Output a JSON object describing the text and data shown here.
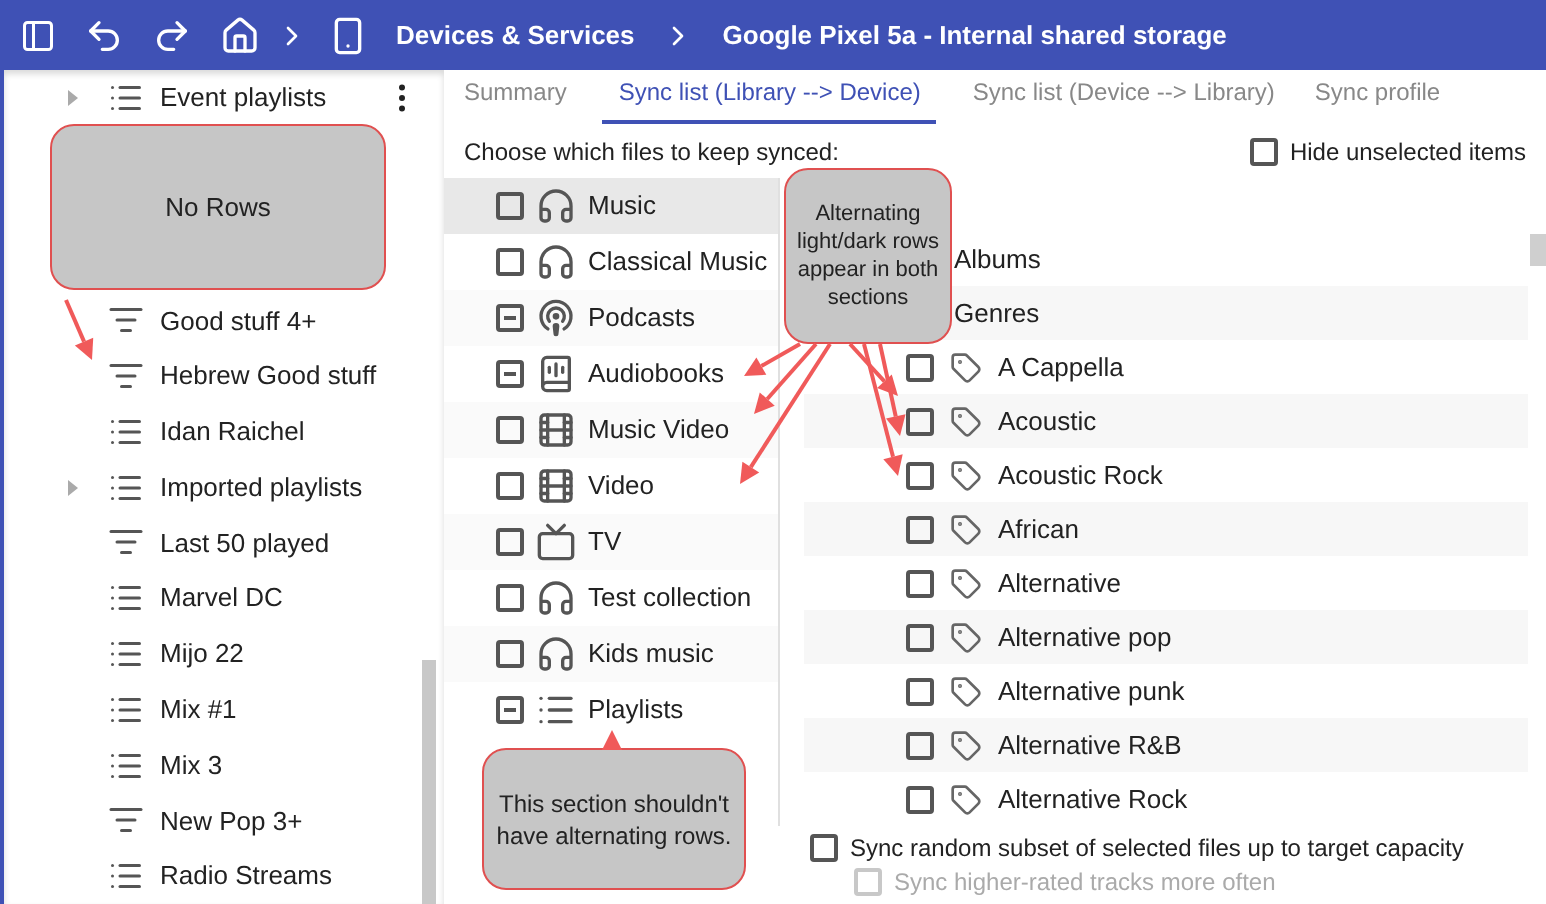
{
  "toolbar": {
    "breadcrumb": [
      "Devices & Services",
      "Google Pixel 5a - Internal shared storage"
    ]
  },
  "sidebar": {
    "items_before": [
      {
        "label": "Event playlists",
        "kind": "list",
        "expandable": true
      }
    ],
    "items_after": [
      {
        "label": "Good stuff 4+",
        "kind": "smart",
        "expandable": false
      },
      {
        "label": "Hebrew Good stuff",
        "kind": "smart",
        "expandable": false
      },
      {
        "label": "Idan Raichel",
        "kind": "list",
        "expandable": false
      },
      {
        "label": "Imported playlists",
        "kind": "list",
        "expandable": true
      },
      {
        "label": "Last 50 played",
        "kind": "smart",
        "expandable": false
      },
      {
        "label": "Marvel DC",
        "kind": "list",
        "expandable": false
      },
      {
        "label": "Mijo 22",
        "kind": "list",
        "expandable": false
      },
      {
        "label": "Mix #1",
        "kind": "list",
        "expandable": false
      },
      {
        "label": "Mix 3",
        "kind": "list",
        "expandable": false
      },
      {
        "label": "New Pop 3+",
        "kind": "smart",
        "expandable": false
      },
      {
        "label": "Radio Streams",
        "kind": "list",
        "expandable": false
      }
    ]
  },
  "tabs": [
    {
      "label": "Summary",
      "selected": false
    },
    {
      "label": "Sync list (Library --> Device)",
      "selected": true
    },
    {
      "label": "Sync list (Device --> Library)",
      "selected": false
    },
    {
      "label": "Sync profile",
      "selected": false
    }
  ],
  "prompt": "Choose which files to keep synced:",
  "hide_unselected": {
    "label": "Hide unselected items",
    "checked": false
  },
  "categories": [
    {
      "label": "Music",
      "kind": "headphones",
      "indeterminate": false,
      "selected": true
    },
    {
      "label": "Classical Music",
      "kind": "headphones",
      "indeterminate": false,
      "selected": false
    },
    {
      "label": "Podcasts",
      "kind": "podcast",
      "indeterminate": true,
      "selected": false
    },
    {
      "label": "Audiobooks",
      "kind": "book",
      "indeterminate": true,
      "selected": false
    },
    {
      "label": "Music Video",
      "kind": "film",
      "indeterminate": false,
      "selected": false
    },
    {
      "label": "Video",
      "kind": "film",
      "indeterminate": false,
      "selected": false
    },
    {
      "label": "TV",
      "kind": "tv",
      "indeterminate": false,
      "selected": false
    },
    {
      "label": "Test collection",
      "kind": "headphones",
      "indeterminate": false,
      "selected": false
    },
    {
      "label": "Kids music",
      "kind": "headphones",
      "indeterminate": false,
      "selected": false
    },
    {
      "label": "Playlists",
      "kind": "list",
      "indeterminate": true,
      "selected": false
    }
  ],
  "tree": [
    {
      "label": "Albums"
    },
    {
      "label": "Genres",
      "children": [
        {
          "label": "A Cappella",
          "checked": false
        },
        {
          "label": "Acoustic",
          "checked": false
        },
        {
          "label": "Acoustic Rock",
          "checked": false
        },
        {
          "label": "African",
          "checked": false
        },
        {
          "label": "Alternative",
          "checked": false
        },
        {
          "label": "Alternative pop",
          "checked": false
        },
        {
          "label": "Alternative punk",
          "checked": false
        },
        {
          "label": "Alternative R&B",
          "checked": false
        },
        {
          "label": "Alternative Rock",
          "checked": false
        }
      ]
    }
  ],
  "options": [
    {
      "label": "Sync random subset of selected files up to target capacity",
      "checked": false,
      "disabled": false
    },
    {
      "label": "Sync higher-rated tracks more often",
      "checked": false,
      "disabled": true
    }
  ],
  "callouts": [
    "No Rows",
    "Alternating light/dark rows appear in both sections",
    "This section shouldn't have alternating rows."
  ]
}
